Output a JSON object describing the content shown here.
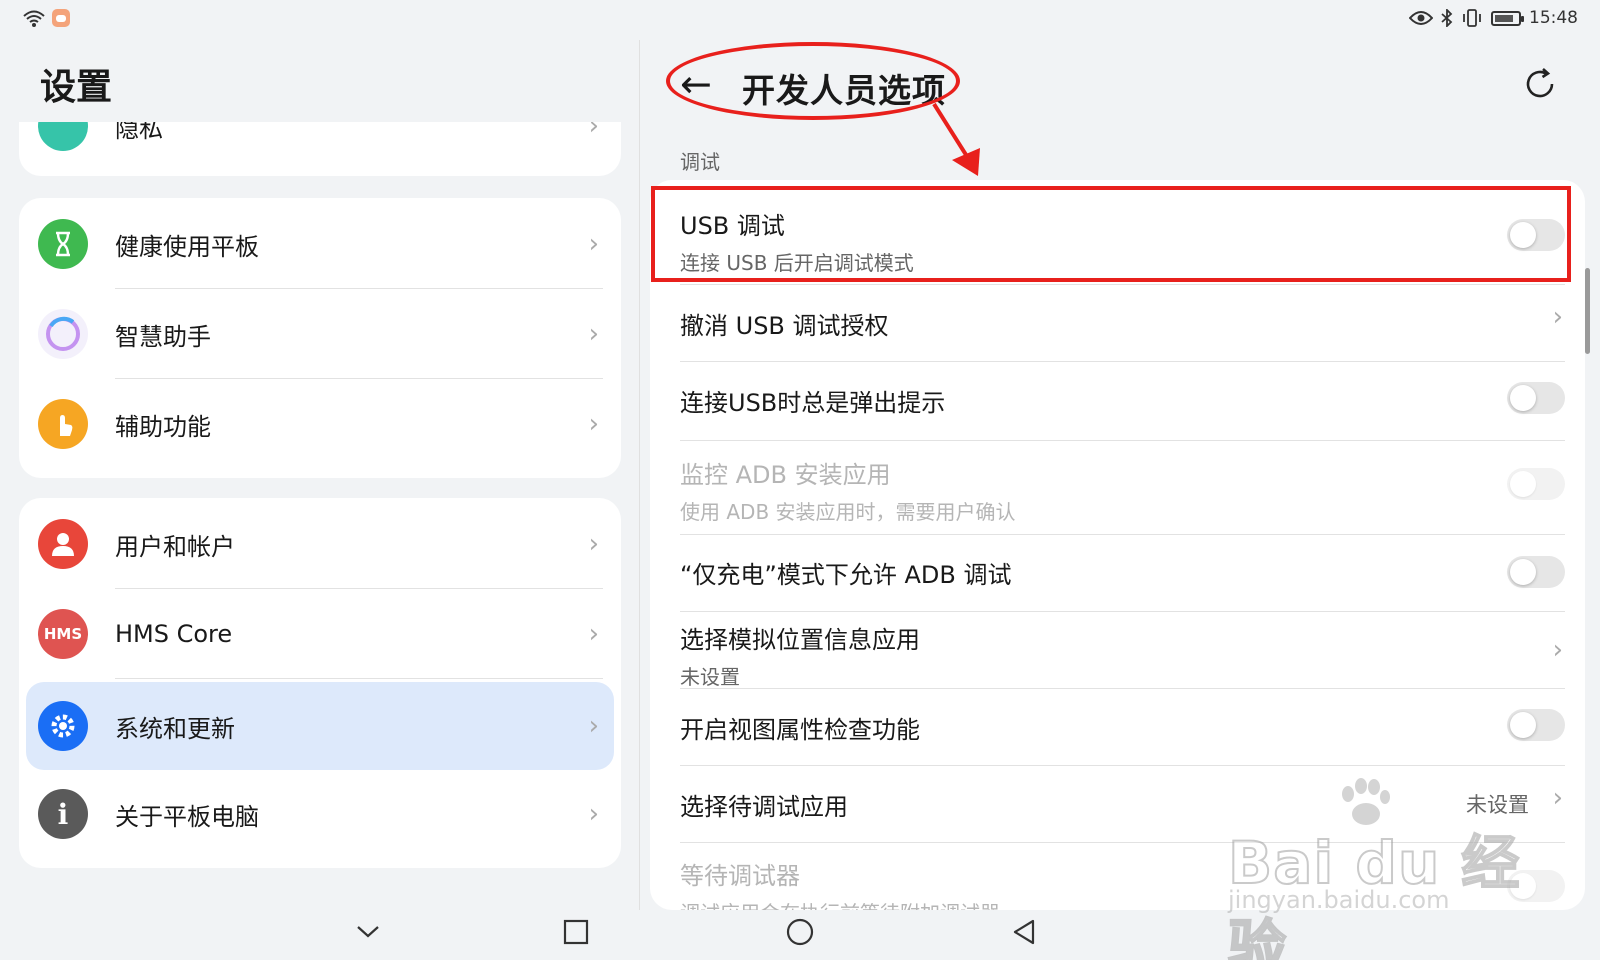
{
  "status_bar": {
    "time": "15:48",
    "icons": [
      "wifi-icon",
      "message-icon",
      "eye-icon",
      "bluetooth-icon",
      "vibrate-icon",
      "battery-icon"
    ]
  },
  "left": {
    "title": "设置",
    "partial_item": "隐私",
    "groups": [
      [
        {
          "label": "健康使用平板",
          "icon": "hourglass-icon",
          "color": "#3fb950"
        },
        {
          "label": "智慧助手",
          "icon": "assistant-icon",
          "color": "#b38cf5"
        },
        {
          "label": "辅助功能",
          "icon": "hand-icon",
          "color": "#f6a623"
        }
      ],
      [
        {
          "label": "用户和帐户",
          "icon": "user-icon",
          "color": "#e8463a"
        },
        {
          "label": "HMS Core",
          "icon": "hms-icon",
          "icon_text": "HMS",
          "color": "#df5451"
        },
        {
          "label": "系统和更新",
          "icon": "gear-icon",
          "color": "#1a6ef5",
          "selected": true
        },
        {
          "label": "关于平板电脑",
          "icon": "info-icon",
          "color": "#5a5a5a"
        }
      ]
    ]
  },
  "right": {
    "title": "开发人员选项",
    "section": "调试",
    "items": [
      {
        "title": "USB 调试",
        "subtitle": "连接 USB 后开启调试模式",
        "control": "toggle"
      },
      {
        "title": "撤消 USB 调试授权",
        "control": "chevron"
      },
      {
        "title": "连接USB时总是弹出提示",
        "control": "toggle"
      },
      {
        "title": "监控 ADB 安装应用",
        "subtitle": "使用 ADB 安装应用时，需要用户确认",
        "control": "toggle",
        "disabled": true
      },
      {
        "title": "“仅充电”模式下允许 ADB 调试",
        "control": "toggle"
      },
      {
        "title": "选择模拟位置信息应用",
        "subtitle": "未设置",
        "control": "chevron"
      },
      {
        "title": "开启视图属性检查功能",
        "control": "toggle"
      },
      {
        "title": "选择待调试应用",
        "value": "未设置",
        "control": "chevron"
      },
      {
        "title": "等待调试器",
        "subtitle": "调试应用会在执行前等待附加调试器",
        "control": "toggle",
        "disabled": true
      }
    ]
  },
  "watermark": {
    "main": "Bai du 经验",
    "sub": "jingyan.baidu.com"
  },
  "colors": {
    "annotation": "#e8201c",
    "selected_bg": "#dde9fb"
  }
}
